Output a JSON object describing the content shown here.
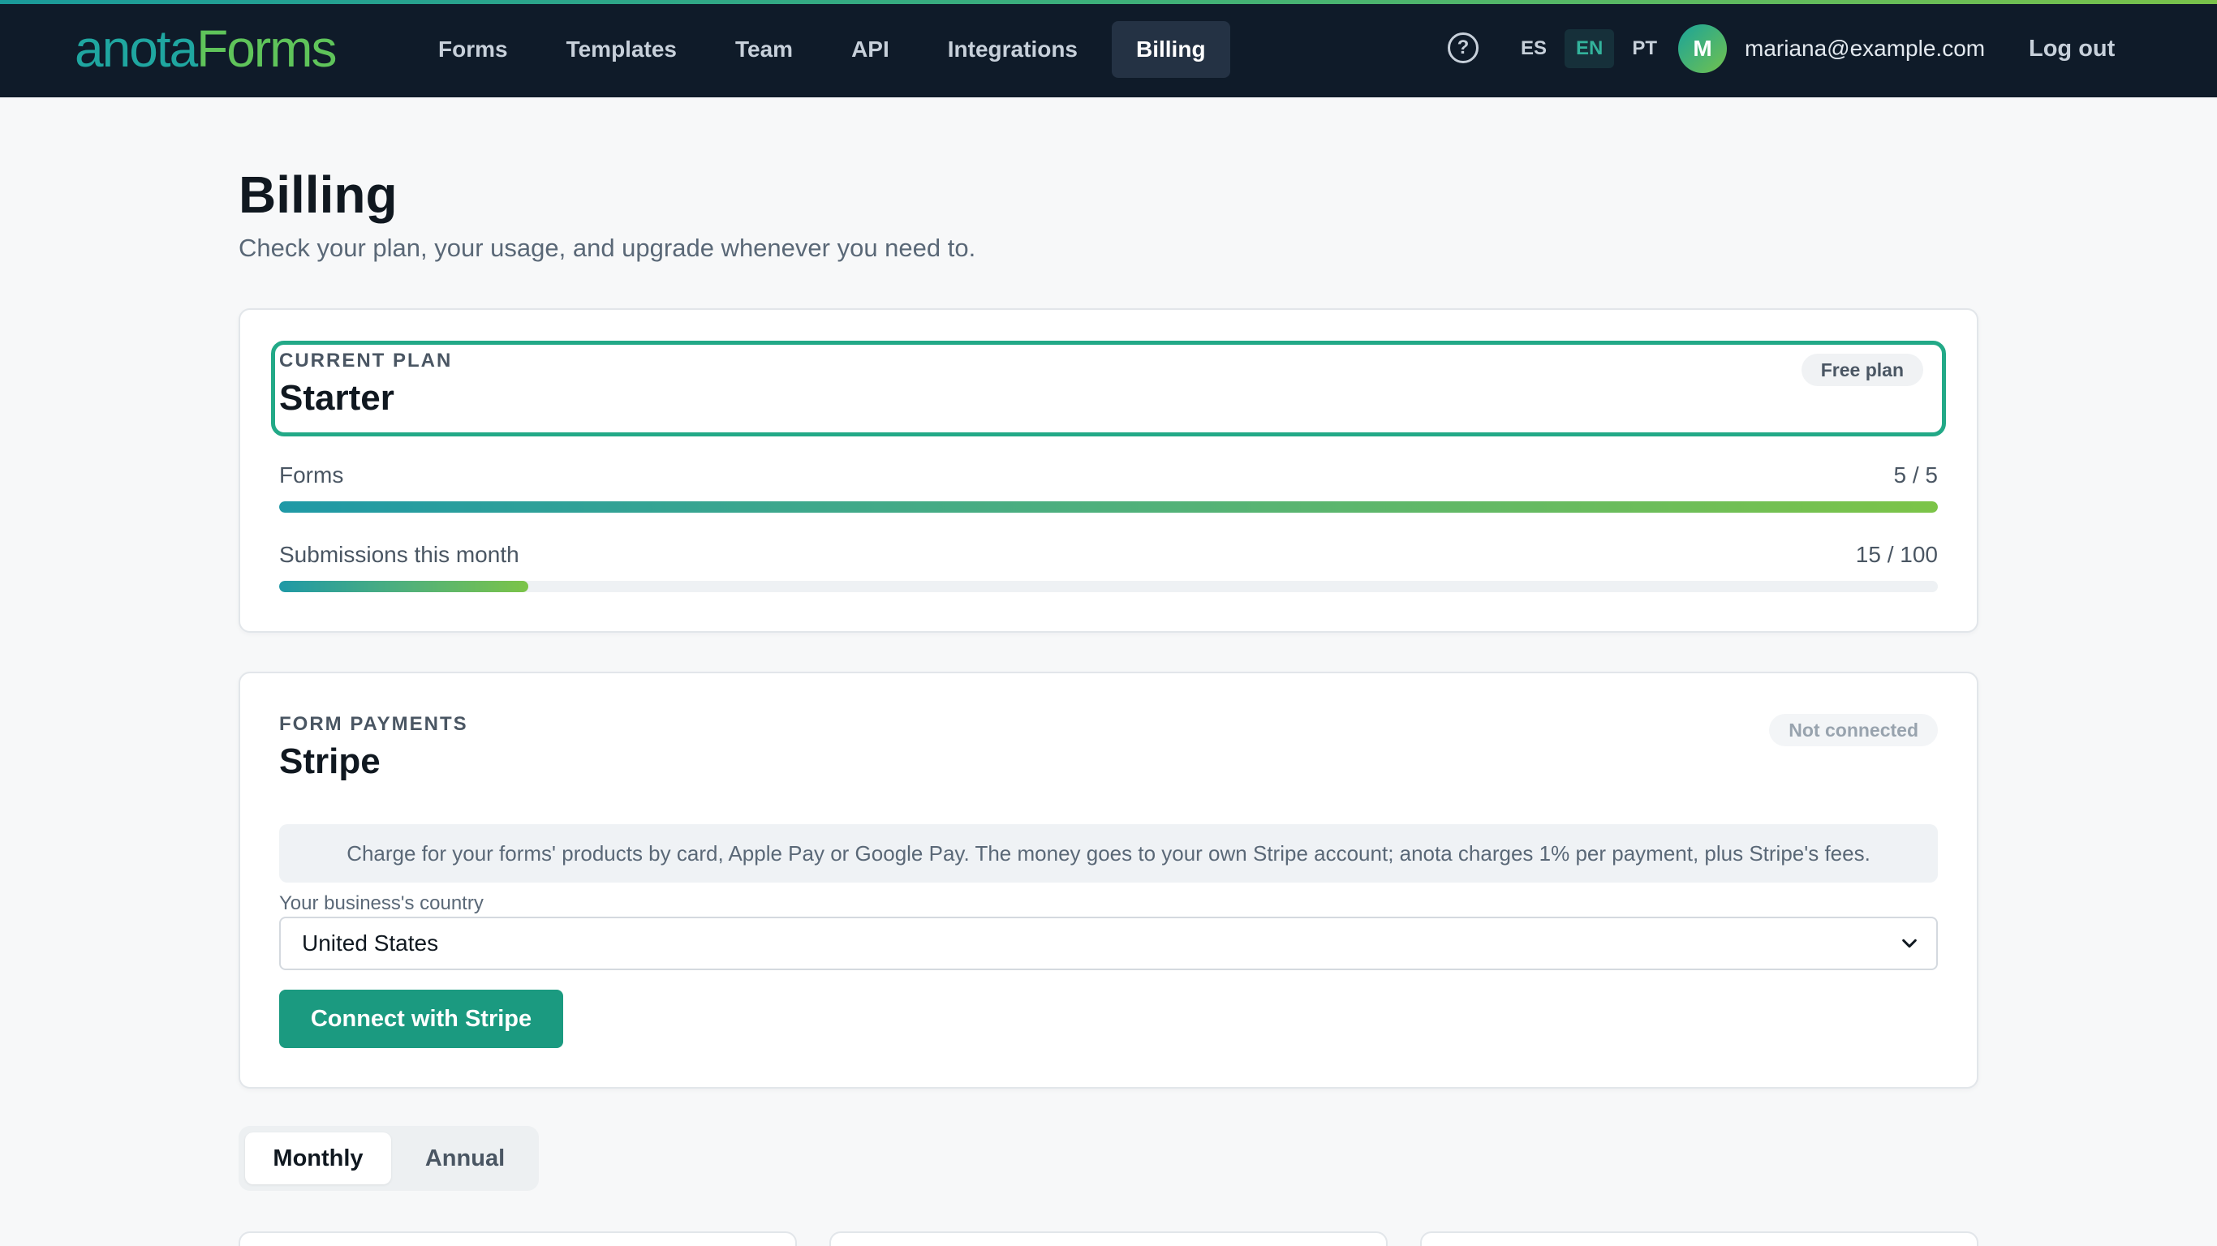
{
  "brand": {
    "name_part1": "anota",
    "name_part2": "Forms"
  },
  "nav": {
    "items": [
      {
        "label": "Forms",
        "active": false
      },
      {
        "label": "Templates",
        "active": false
      },
      {
        "label": "Team",
        "active": false
      },
      {
        "label": "API",
        "active": false
      },
      {
        "label": "Integrations",
        "active": false
      },
      {
        "label": "Billing",
        "active": true
      }
    ],
    "help_icon": "question-circle-icon",
    "help_glyph": "?",
    "languages": [
      {
        "code": "ES",
        "active": false
      },
      {
        "code": "EN",
        "active": true
      },
      {
        "code": "PT",
        "active": false
      }
    ],
    "user": {
      "initial": "M",
      "email": "mariana@example.com"
    },
    "logout_label": "Log out"
  },
  "header": {
    "title": "Billing",
    "subtitle": "Check your plan, your usage, and upgrade whenever you need to."
  },
  "plan_card": {
    "eyebrow": "CURRENT PLAN",
    "plan_name": "Starter",
    "badge": "Free plan",
    "usage": [
      {
        "label": "Forms",
        "value": "5 / 5",
        "fraction": 1.0
      },
      {
        "label": "Submissions this month",
        "value": "15 / 100",
        "fraction": 0.15
      }
    ]
  },
  "payments_card": {
    "eyebrow": "FORM PAYMENTS",
    "title": "Stripe",
    "status_badge": "Not connected",
    "info": "Charge for your forms' products by card, Apple Pay or Google Pay. The money goes to your own Stripe account; anota charges 1% per payment, plus Stripe's fees.",
    "country_label": "Your business's country",
    "country_value": "United States",
    "connect_label": "Connect with Stripe"
  },
  "billing_period": {
    "options": [
      {
        "label": "Monthly",
        "active": true
      },
      {
        "label": "Annual",
        "active": false
      }
    ]
  },
  "colors": {
    "nav_bg": "#0f1b29",
    "accent": "#22a987",
    "primary_button": "#1b9a80"
  }
}
